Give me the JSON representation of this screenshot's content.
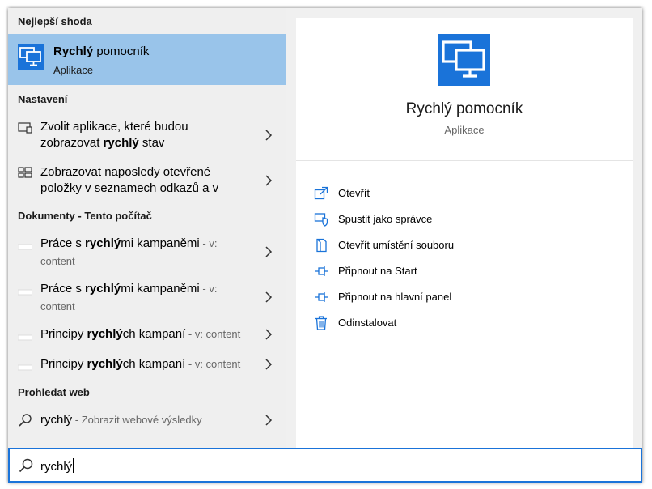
{
  "sections": {
    "best_match": "Nejlepší shoda",
    "settings": "Nastavení",
    "documents": "Dokumenty - Tento počítač",
    "web": "Prohledat web"
  },
  "best_match": {
    "title_bold": "Rychlý",
    "title_rest": " pomocník",
    "subtitle": "Aplikace"
  },
  "settings_items": [
    {
      "line1": "Zvolit aplikace, které budou",
      "line2_pre": "zobrazovat ",
      "line2_bold": "rychlý",
      "line2_post": " stav"
    },
    {
      "line1": "Zobrazovat naposledy otevřené",
      "line2": "položky v seznamech odkazů a v"
    }
  ],
  "documents": [
    {
      "pre": "Práce s ",
      "bold": "rychlý",
      "post": "mi kampaněmi",
      "loc1": " - v:",
      "loc2": "content"
    },
    {
      "pre": "Práce s ",
      "bold": "rychlý",
      "post": "mi kampaněmi",
      "loc1": " - v:",
      "loc2": "content"
    },
    {
      "pre": "Principy ",
      "bold": "rychlý",
      "post": "ch kampaní",
      "loc": " - v: content"
    },
    {
      "pre": "Principy ",
      "bold": "rychlý",
      "post": "ch kampaní",
      "loc": " - v: content"
    }
  ],
  "web": {
    "query": "rychlý",
    "hint": " - Zobrazit webové výsledky"
  },
  "detail": {
    "name": "Rychlý pomocník",
    "type": "Aplikace",
    "actions": [
      {
        "label": "Otevřít",
        "icon": "open-icon"
      },
      {
        "label": "Spustit jako správce",
        "icon": "shield-icon"
      },
      {
        "label": "Otevřít umístění souboru",
        "icon": "file-location-icon"
      },
      {
        "label": "Připnout na Start",
        "icon": "pin-icon"
      },
      {
        "label": "Připnout na hlavní panel",
        "icon": "pin-icon"
      },
      {
        "label": "Odinstalovat",
        "icon": "trash-icon"
      }
    ]
  },
  "search": {
    "value": "rychlý"
  },
  "colors": {
    "accent": "#1a73d9",
    "selection": "#99c4ea"
  }
}
